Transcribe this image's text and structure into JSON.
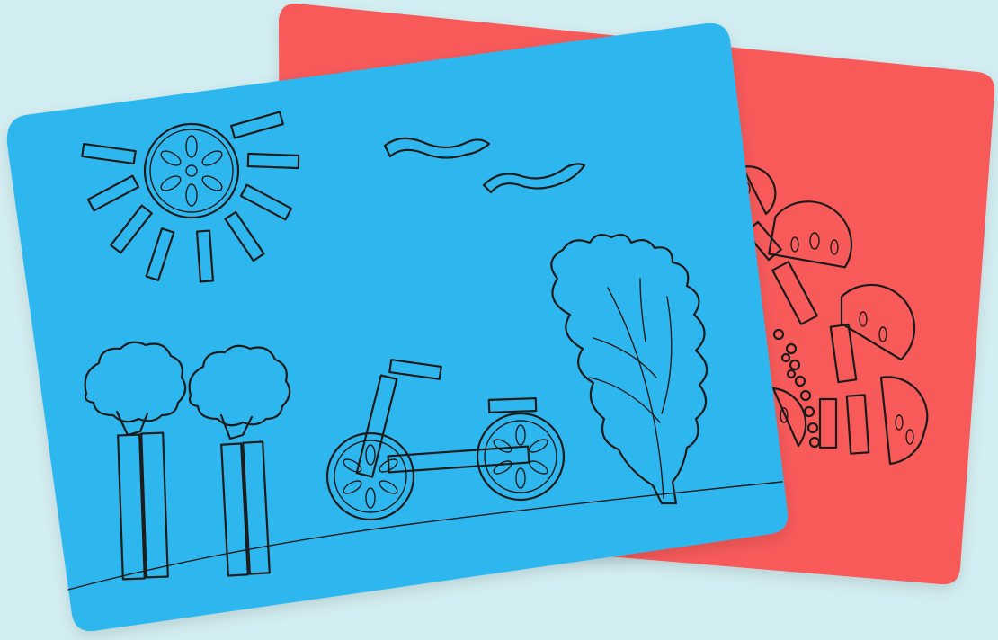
{
  "scene": {
    "background_color": "#d3eef2",
    "back_mat": {
      "color": "#f85a5a",
      "theme": "cloud"
    },
    "front_mat": {
      "color": "#2db7ee",
      "theme": "outdoor scene"
    }
  },
  "icons": {
    "sun": "tomato-slice-sun-icon",
    "birds": "seaweed-bird-icon",
    "trees": "broccoli-tree-icon",
    "bike": "balance-bike-icon",
    "bush": "lettuce-leaf-icon",
    "cloud": "tomato-cloud-icon"
  }
}
